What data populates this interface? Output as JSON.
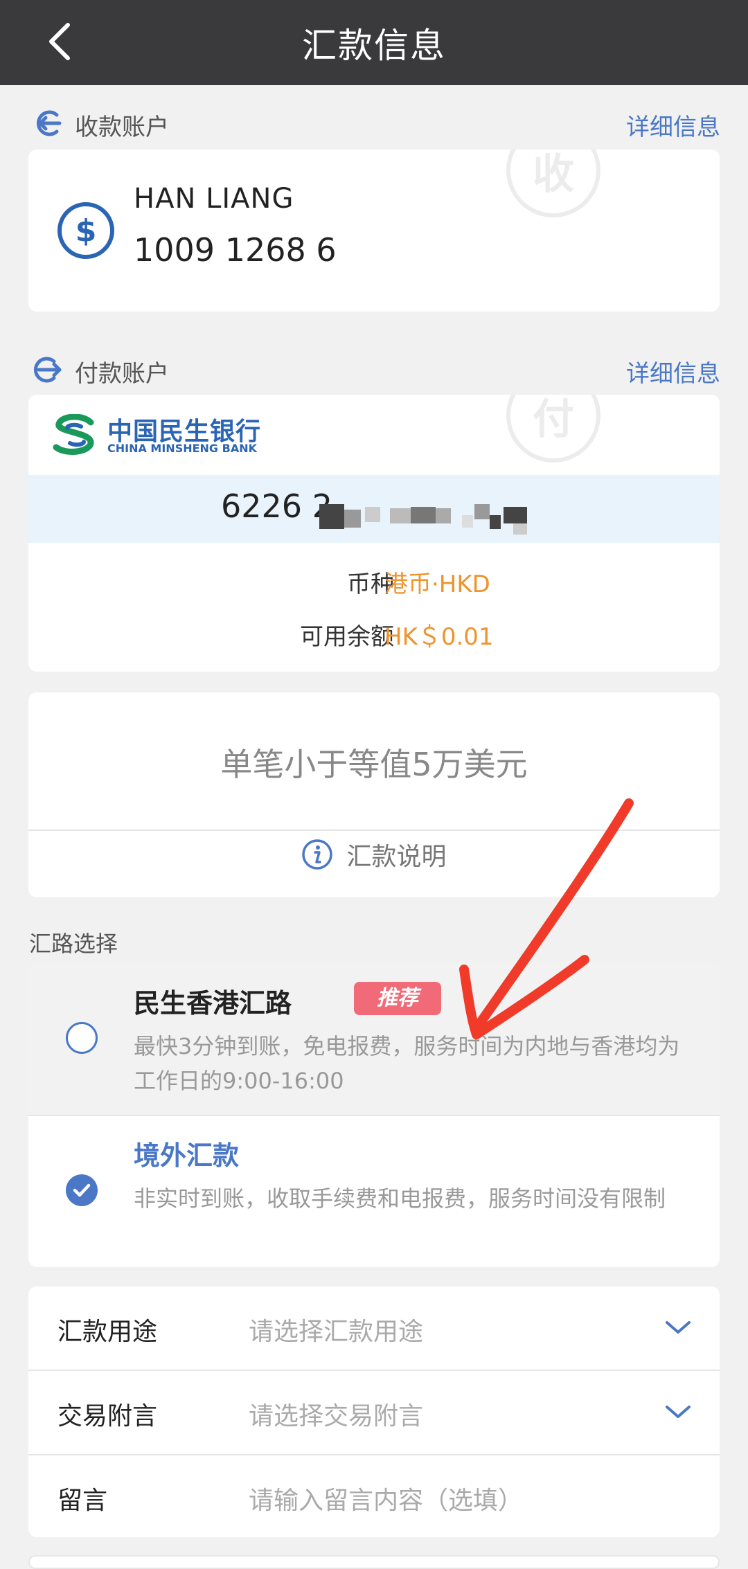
{
  "header": {
    "title": "汇款信息"
  },
  "payee": {
    "section_label": "收款账户",
    "detail_link": "详细信息",
    "name": "HAN LIANG",
    "account": "1009 1268 6",
    "watermark": "收"
  },
  "payer": {
    "section_label": "付款账户",
    "detail_link": "详细信息",
    "bank_name_cn": "中国民生银行",
    "bank_name_en": "CHINA MINSHENG BANK",
    "account_prefix": "6226 2",
    "watermark": "付",
    "currency_label": "币种",
    "currency_value": "港币·HKD",
    "balance_label": "可用余额",
    "balance_value": "HK＄0.01"
  },
  "limit": {
    "text": "单笔小于等值5万美元",
    "explain_label": "汇款说明"
  },
  "routes": {
    "title": "汇路选择",
    "items": [
      {
        "name": "民生香港汇路",
        "badge": "推荐",
        "desc": "最快3分钟到账，免电报费，服务时间为内地与香港均为工作日的9:00-16:00",
        "selected": false
      },
      {
        "name": "境外汇款",
        "desc": "非实时到账，收取手续费和电报费，服务时间没有限制",
        "selected": true
      }
    ]
  },
  "form": {
    "purpose_label": "汇款用途",
    "purpose_placeholder": "请选择汇款用途",
    "note_label": "交易附言",
    "note_placeholder": "请选择交易附言",
    "message_label": "留言",
    "message_placeholder": "请输入留言内容（选填）"
  },
  "colors": {
    "accent": "#4a78c7",
    "orange": "#f0932b",
    "header": "#3a3a3c",
    "badge": "#f06a78",
    "annotation": "#f03a2a"
  }
}
